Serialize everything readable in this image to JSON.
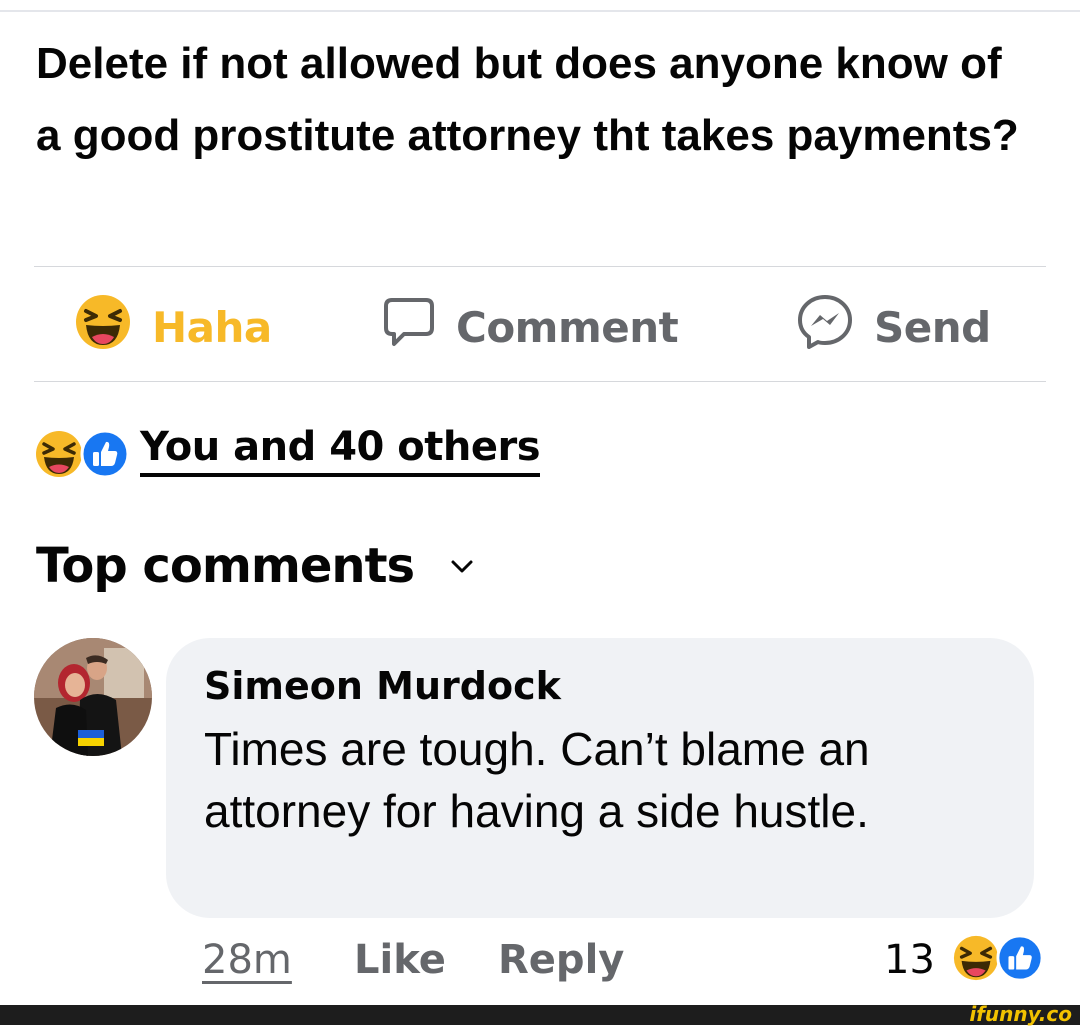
{
  "post": {
    "text": "Delete if not allowed but does anyone know of a good prostitute attorney tht takes payments?"
  },
  "actions": {
    "haha_label": "Haha",
    "comment_label": "Comment",
    "send_label": "Send"
  },
  "reactions": {
    "summary_text": "You and 40 others",
    "icons": [
      "haha-icon",
      "like-icon"
    ]
  },
  "comments_section": {
    "title": "Top comments",
    "sort_icon": "chevron-down-icon"
  },
  "comment": {
    "author": "Simeon Murdock",
    "text": "Times are tough. Can’t blame an attorney for having a side hustle.",
    "time": "28m",
    "like_label": "Like",
    "reply_label": "Reply",
    "reaction_count": "13"
  },
  "colors": {
    "haha_yellow": "#f7b928",
    "like_blue": "#1877f2",
    "muted_gray": "#65676b",
    "bubble_bg": "#f0f2f5",
    "watermark_yellow": "#f2c200"
  },
  "watermark": "ifunny.co"
}
